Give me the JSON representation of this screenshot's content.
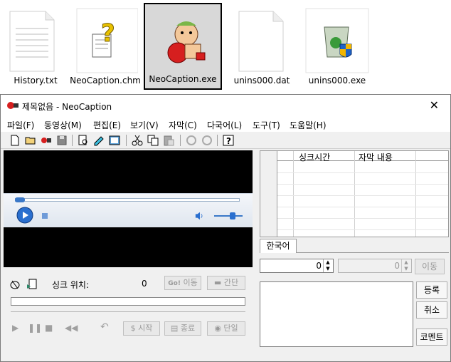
{
  "desktop_files": [
    {
      "label": "History.txt",
      "icon": "text-file-icon"
    },
    {
      "label": "NeoCaption.chm",
      "icon": "help-file-icon"
    },
    {
      "label": "NeoCaption.exe",
      "icon": "neocaption-app-icon"
    },
    {
      "label": "unins000.dat",
      "icon": "blank-file-icon"
    },
    {
      "label": "unins000.exe",
      "icon": "uninstaller-icon"
    }
  ],
  "window": {
    "title": "제목없음 - NeoCaption",
    "close": "✕"
  },
  "menu": [
    "파일(F)",
    "동영상(M)",
    "편집(E)",
    "보기(V)",
    "자막(C)",
    "다국어(L)",
    "도구(T)",
    "도움말(H)"
  ],
  "toolbar": [
    "new-file-icon",
    "open-folder-icon",
    "record-icon",
    "save-icon",
    "print-preview-icon",
    "edit-icon",
    "subtitle-view-icon",
    "cut-icon",
    "copy-icon",
    "paste-icon",
    "undo-icon",
    "redo-icon",
    "help-icon"
  ],
  "sync": {
    "label": "싱크 위치:",
    "value": "0",
    "go_button": "이동",
    "gap_button": "간단"
  },
  "controls": {
    "start": "시작",
    "end": "종료",
    "single": "단일"
  },
  "grid": {
    "col_sync": "싱크시간",
    "col_text": "자막 내용"
  },
  "language_tab": "한국어",
  "spin1": "0",
  "spin2": "0",
  "move_button": "이동",
  "side_buttons": {
    "register": "등록",
    "cancel": "취소",
    "comment": "코멘트"
  },
  "colors": {
    "accent": "#2a6fcf",
    "video": "#000000",
    "disabled_text": "#9a9a9a"
  }
}
